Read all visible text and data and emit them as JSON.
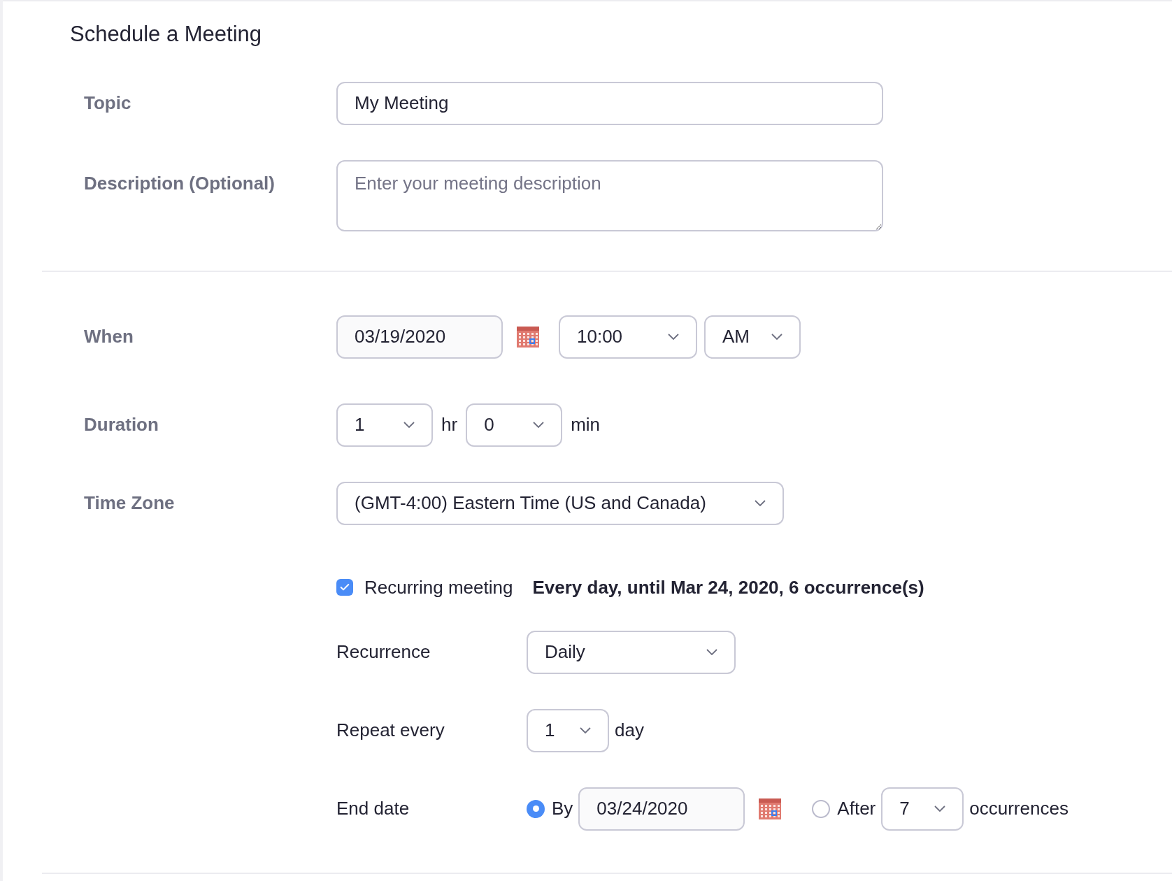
{
  "title": "Schedule a Meeting",
  "topic": {
    "label": "Topic",
    "value": "My Meeting"
  },
  "description": {
    "label": "Description (Optional)",
    "placeholder": "Enter your meeting description"
  },
  "when": {
    "label": "When",
    "date": "03/19/2020",
    "time": "10:00",
    "ampm": "AM"
  },
  "duration": {
    "label": "Duration",
    "hours": "1",
    "hours_unit": "hr",
    "minutes": "0",
    "minutes_unit": "min"
  },
  "time_zone": {
    "label": "Time Zone",
    "value": "(GMT-4:00) Eastern Time (US and Canada)"
  },
  "recurring": {
    "label": "Recurring meeting",
    "checked": true,
    "summary": "Every day, until Mar 24, 2020, 6 occurrence(s)"
  },
  "recurrence": {
    "label": "Recurrence",
    "value": "Daily"
  },
  "repeat_every": {
    "label": "Repeat every",
    "value": "1",
    "unit": "day"
  },
  "end_date": {
    "label": "End date",
    "options": [
      {
        "kind": "date",
        "label": "By",
        "selected": true,
        "value": "03/24/2020"
      },
      {
        "kind": "count",
        "label": "After",
        "selected": false,
        "value": "7",
        "unit": "occurrences"
      }
    ]
  }
}
